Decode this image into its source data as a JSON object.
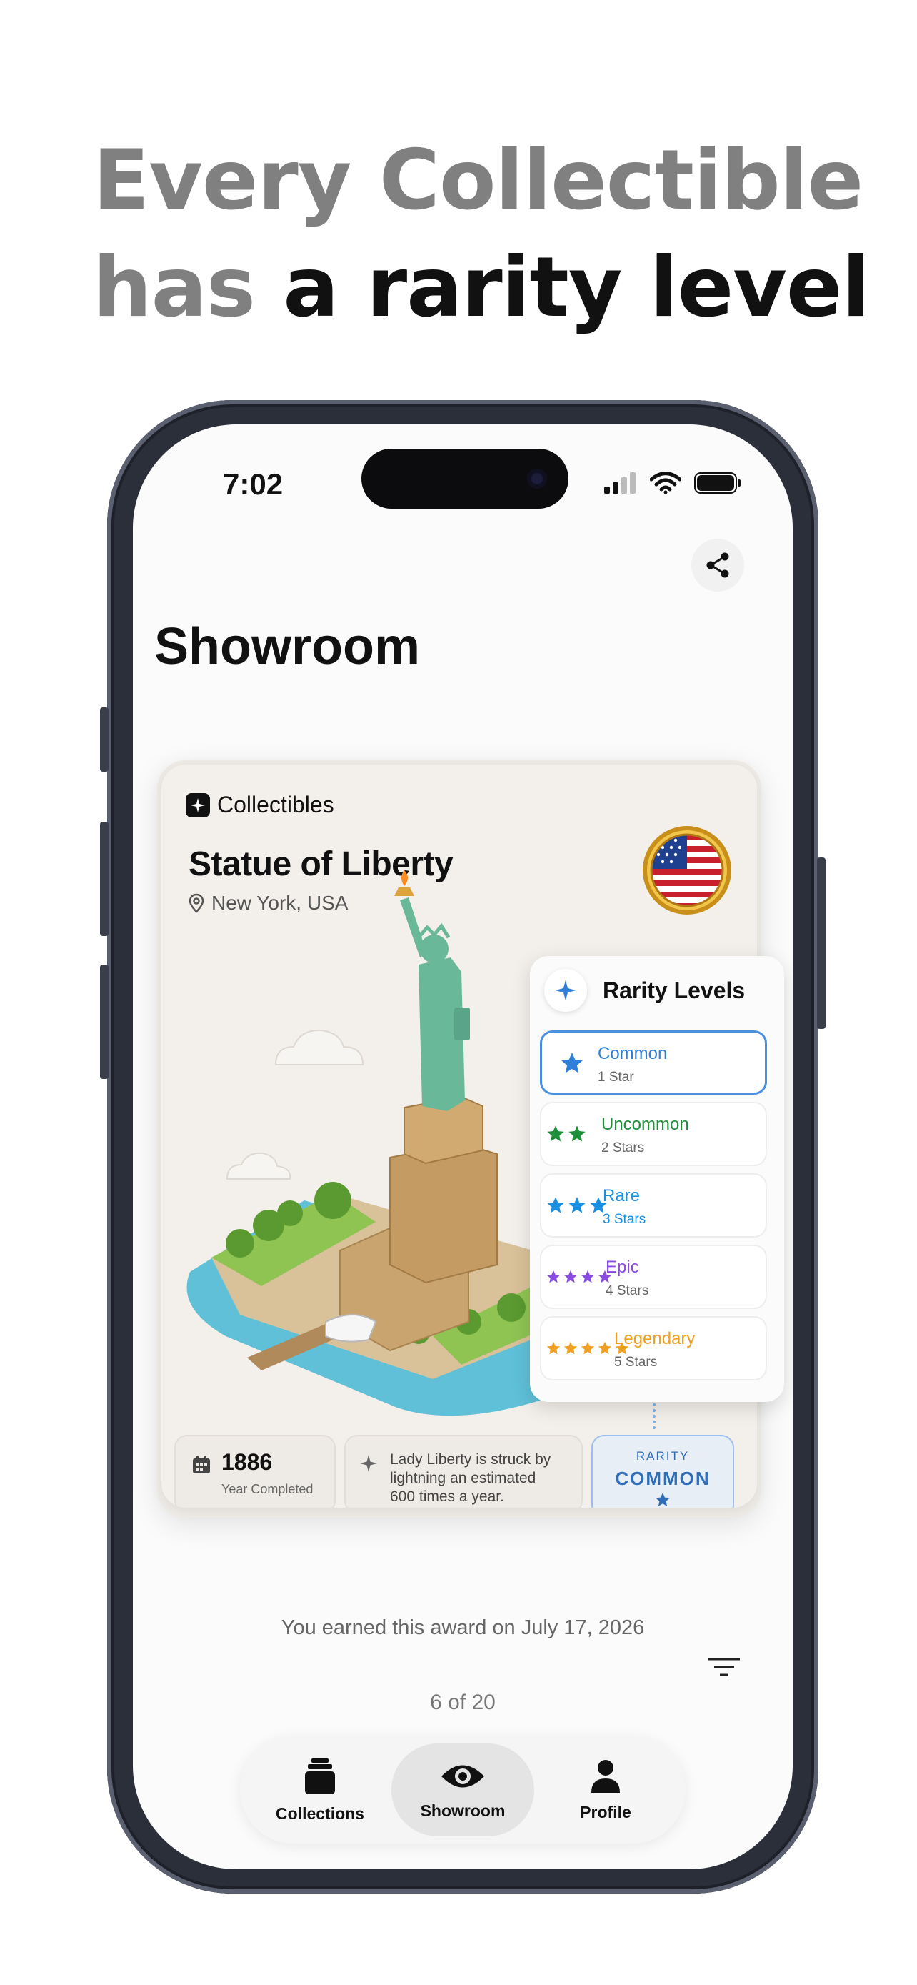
{
  "headline": {
    "line1": "Every Collectible",
    "line2_grey": "has",
    "line2_dark": "a rarity level"
  },
  "status": {
    "time": "7:02"
  },
  "page": {
    "title": "Showroom"
  },
  "card": {
    "brand": "Collectibles",
    "name": "Statue of Liberty",
    "location": "New York, USA",
    "year": "1886",
    "year_label": "Year Completed",
    "fact": "Lady Liberty is struck by lightning an estimated 600 times a year.",
    "rarity_label": "RARITY",
    "rarity_value": "COMMON"
  },
  "rarity_panel": {
    "title": "Rarity Levels",
    "levels": [
      {
        "name": "Common",
        "sub": "1 Star",
        "stars": 1,
        "color": "#2f7fd8",
        "selected": true
      },
      {
        "name": "Uncommon",
        "sub": "2 Stars",
        "stars": 2,
        "color": "#1e8f3a",
        "selected": false
      },
      {
        "name": "Rare",
        "sub": "3 Stars",
        "stars": 3,
        "color": "#1a8ee0",
        "selected": false
      },
      {
        "name": "Epic",
        "sub": "4 Stars",
        "stars": 4,
        "color": "#8a4be0",
        "selected": false
      },
      {
        "name": "Legendary",
        "sub": "5 Stars",
        "stars": 5,
        "color": "#f0a020",
        "selected": false
      }
    ]
  },
  "award_text": "You earned this award on July 17, 2026",
  "pager": "6 of 20",
  "tabs": [
    {
      "label": "Collections",
      "icon": "collections-icon",
      "active": false
    },
    {
      "label": "Showroom",
      "icon": "eye-icon",
      "active": true
    },
    {
      "label": "Profile",
      "icon": "person-icon",
      "active": false
    }
  ],
  "colors": {
    "accent_blue": "#2f6db8",
    "card_bg": "#f3efeb",
    "headline_grey": "#808080"
  }
}
